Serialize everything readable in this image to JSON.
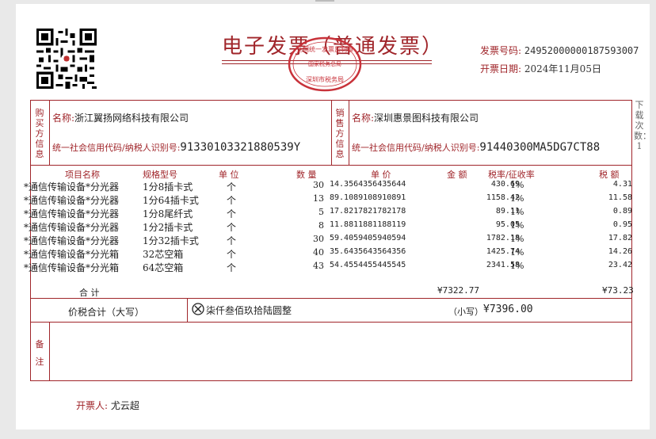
{
  "invoice": {
    "title": "电子发票（普通发票）",
    "number_label": "发票号码:",
    "number": "24952000000187593007",
    "date_label": "开票日期:",
    "date": "2024年11月05日",
    "seal_text_top": "全国统一发票监制章",
    "seal_text_mid": "国家税务总局",
    "seal_text_bottom": "深圳市税务局"
  },
  "buyer": {
    "side_label": "购买方信息",
    "name_label": "名称:",
    "name": "浙江翼扬网络科技有限公司",
    "tax_label": "统一社会信用代码/纳税人识别号:",
    "tax_id": "91330103321880539Y"
  },
  "seller": {
    "side_label": "销售方信息",
    "name_label": "名称:",
    "name": "深圳惠景图科技有限公司",
    "tax_label": "统一社会信用代码/纳税人识别号:",
    "tax_id": "91440300MA5DG7CT88"
  },
  "columns": {
    "item": "项目名称",
    "spec": "规格型号",
    "unit": "单 位",
    "qty": "数 量",
    "price": "单 价",
    "amount": "金 额",
    "rate": "税率/征收率",
    "tax": "税 额"
  },
  "items": [
    {
      "name": "*通信传输设备*分光器",
      "spec": "1分8插卡式",
      "unit": "个",
      "qty": "30",
      "price": "14.3564356435644",
      "amount": "430.69",
      "rate": "1%",
      "tax": "4.31"
    },
    {
      "name": "*通信传输设备*分光器",
      "spec": "1分64插卡式",
      "unit": "个",
      "qty": "13",
      "price": "89.1089108910891",
      "amount": "1158.42",
      "rate": "1%",
      "tax": "11.58"
    },
    {
      "name": "*通信传输设备*分光器",
      "spec": "1分8尾纤式",
      "unit": "个",
      "qty": "5",
      "price": "17.8217821782178",
      "amount": "89.11",
      "rate": "1%",
      "tax": "0.89"
    },
    {
      "name": "*通信传输设备*分光器",
      "spec": "1分2插卡式",
      "unit": "个",
      "qty": "8",
      "price": "11.8811881188119",
      "amount": "95.05",
      "rate": "1%",
      "tax": "0.95"
    },
    {
      "name": "*通信传输设备*分光器",
      "spec": "1分32插卡式",
      "unit": "个",
      "qty": "30",
      "price": "59.4059405940594",
      "amount": "1782.18",
      "rate": "1%",
      "tax": "17.82"
    },
    {
      "name": "*通信传输设备*分光箱",
      "spec": "32芯空箱",
      "unit": "个",
      "qty": "40",
      "price": "35.6435643564356",
      "amount": "1425.74",
      "rate": "1%",
      "tax": "14.26"
    },
    {
      "name": "*通信传输设备*分光箱",
      "spec": "64芯空箱",
      "unit": "个",
      "qty": "43",
      "price": "54.4554455445545",
      "amount": "2341.58",
      "rate": "1%",
      "tax": "23.42"
    }
  ],
  "totals": {
    "label": "合 计",
    "amount": "¥7322.77",
    "tax": "¥73.23",
    "grand_label": "价税合计（大写）",
    "grand_words": "柒仟叁佰玖拾陆圆整",
    "small_label": "（小写）",
    "grand_number": "¥7396.00"
  },
  "remarks": {
    "label": "备注"
  },
  "issuer": {
    "label": "开票人:",
    "name": "尤云超"
  },
  "side_note": "下载次数：1"
}
